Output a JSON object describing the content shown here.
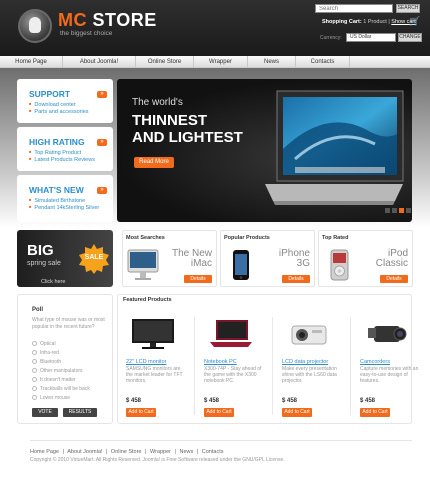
{
  "header": {
    "logo_mc": "MC",
    "logo_store": "STORE",
    "tagline": "the biggest choice",
    "search_placeholder": "Search",
    "search_button": "SEARCH",
    "cart_label": "Shopping Cart:",
    "cart_count": "1 Product",
    "cart_link": "Show cart",
    "currency_label": "Currency:",
    "currency_value": "US Dollar",
    "change_button": "CHANGE"
  },
  "nav": {
    "items": [
      {
        "label": "Home Page"
      },
      {
        "label": "About Joomla!"
      },
      {
        "label": "Online Store"
      },
      {
        "label": "Wrapper"
      },
      {
        "label": "News"
      },
      {
        "label": "Contacts"
      }
    ]
  },
  "sidebar": {
    "support": {
      "title": "SUPPORT",
      "links": [
        "Download center",
        "Parts and accessories"
      ]
    },
    "high_rating": {
      "title": "HIGH RATING",
      "links": [
        "Top Rating Product",
        "Latest Products Reviews"
      ]
    },
    "whats_new": {
      "title": "WHAT'S NEW",
      "links": [
        "Simulated Birthstone",
        "Pendant 14kSterling Silver"
      ]
    },
    "arrow": "»"
  },
  "hero": {
    "line1": "The world's",
    "line2": "THINNEST",
    "line3": "AND LIGHTEST",
    "button": "Read More",
    "active_slide": 2,
    "slide_count": 4
  },
  "promo": {
    "big": "BIG",
    "sub": "spring sale",
    "badge": "SALE",
    "more": "Click here"
  },
  "cards": [
    {
      "title": "Most Searches",
      "name1": "The New",
      "name2": "iMac",
      "button": "Details",
      "image": "imac-image"
    },
    {
      "title": "Popular Products",
      "name1": "iPhone",
      "name2": "3G",
      "button": "Details",
      "image": "iphone-image"
    },
    {
      "title": "Top Rated",
      "name1": "iPod",
      "name2": "Classic",
      "button": "Details",
      "image": "ipod-image"
    }
  ],
  "poll": {
    "title": "Poll",
    "question": "What type of mouse was or most popular in the recent future?",
    "options": [
      "Optical",
      "Infra-red",
      "Bluetooth",
      "Other manipulators",
      "It doesn't matter",
      "Trackballs will be back",
      "Lower mouse"
    ],
    "vote": "VOTE",
    "results": "RESULTS"
  },
  "featured": {
    "title": "Featured Products",
    "products": [
      {
        "name": "22\" LCD monitor",
        "desc": "SAMSUNG monitors are the market leader for TFT monitors.",
        "price": "$ 458",
        "cart": "Add to Cart",
        "image": "monitor-image"
      },
      {
        "name": "Notebook PC",
        "desc": "X300-74P - Stay ahead of the game with the X300 notebook PC.",
        "price": "$ 458",
        "cart": "Add to Cart",
        "image": "notebook-image"
      },
      {
        "name": "LCD data projector",
        "desc": "Make every presentation shine with the LS60 data projector.",
        "price": "$ 458",
        "cart": "Add to Cart",
        "image": "projector-image"
      },
      {
        "name": "Camcorders",
        "desc": "Capture memories with an easy-to-use design of features.",
        "price": "$ 458",
        "cart": "Add to Cart",
        "image": "camcorder-image"
      }
    ]
  },
  "footer": {
    "links": [
      "Home Page",
      "About Joomla!",
      "Online Store",
      "Wrapper",
      "News",
      "Contacts"
    ],
    "separator": "|",
    "copyright": "Copyright © 2010 VirtueMart. All Rights Reserved. Joomla! is Free Software released under the GNU/GPL License."
  },
  "colors": {
    "accent": "#f26b1d",
    "link": "#2c8fc9",
    "header": "#222222"
  }
}
